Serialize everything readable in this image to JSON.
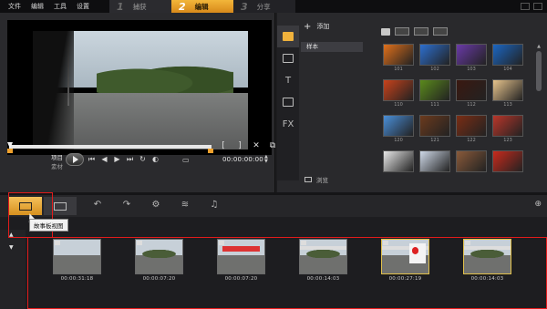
{
  "menu": [
    "文件",
    "编辑",
    "工具",
    "设置"
  ],
  "steps": [
    {
      "num": "1",
      "label": "捕获"
    },
    {
      "num": "2",
      "label": "编辑"
    },
    {
      "num": "3",
      "label": "分享"
    }
  ],
  "preview": {
    "mode_label": "项目",
    "mode_sub": "素材",
    "timecode": "00:00:00:00",
    "mark_in": "[",
    "mark_out": "]"
  },
  "library": {
    "add_label": "添加",
    "folder_name": "样本",
    "browse_label": "浏览",
    "thumbs": [
      {
        "cap": "101",
        "color": "#e0701b"
      },
      {
        "cap": "102",
        "color": "#2d6fcf"
      },
      {
        "cap": "103",
        "color": "#6a3aa8"
      },
      {
        "cap": "104",
        "color": "#1b66c2"
      },
      {
        "cap": "110",
        "color": "#c8421b"
      },
      {
        "cap": "111",
        "color": "#5a8a1c"
      },
      {
        "cap": "112",
        "color": "#3a1810"
      },
      {
        "cap": "113",
        "color": "#e7c48d"
      },
      {
        "cap": "120",
        "color": "#4a8fd8"
      },
      {
        "cap": "121",
        "color": "#6b3a1d"
      },
      {
        "cap": "122",
        "color": "#7a2d14"
      },
      {
        "cap": "123",
        "color": "#b8362a"
      },
      {
        "cap": "",
        "color": "#e8e8e8"
      },
      {
        "cap": "",
        "color": "#cfd9e8"
      },
      {
        "cap": "",
        "color": "#8a5a3a"
      },
      {
        "cap": "",
        "color": "#c82a1c"
      }
    ]
  },
  "timeline": {
    "tooltip": "故事板视图"
  },
  "clips": [
    {
      "tc": "00:00:31:18",
      "type": "road",
      "selected": false
    },
    {
      "tc": "00:00:07:20",
      "type": "tree",
      "selected": false
    },
    {
      "tc": "00:00:07:20",
      "type": "station",
      "selected": false
    },
    {
      "tc": "00:00:14:03",
      "type": "canopy",
      "selected": false
    },
    {
      "tc": "00:00:27:19",
      "type": "sign",
      "selected": true
    },
    {
      "tc": "00:00:14:03",
      "type": "canopy",
      "selected": true
    }
  ],
  "colors": {
    "accent": "#f0b23c",
    "highlight": "#e21b1b",
    "selected_clip": "#e1c04a"
  }
}
